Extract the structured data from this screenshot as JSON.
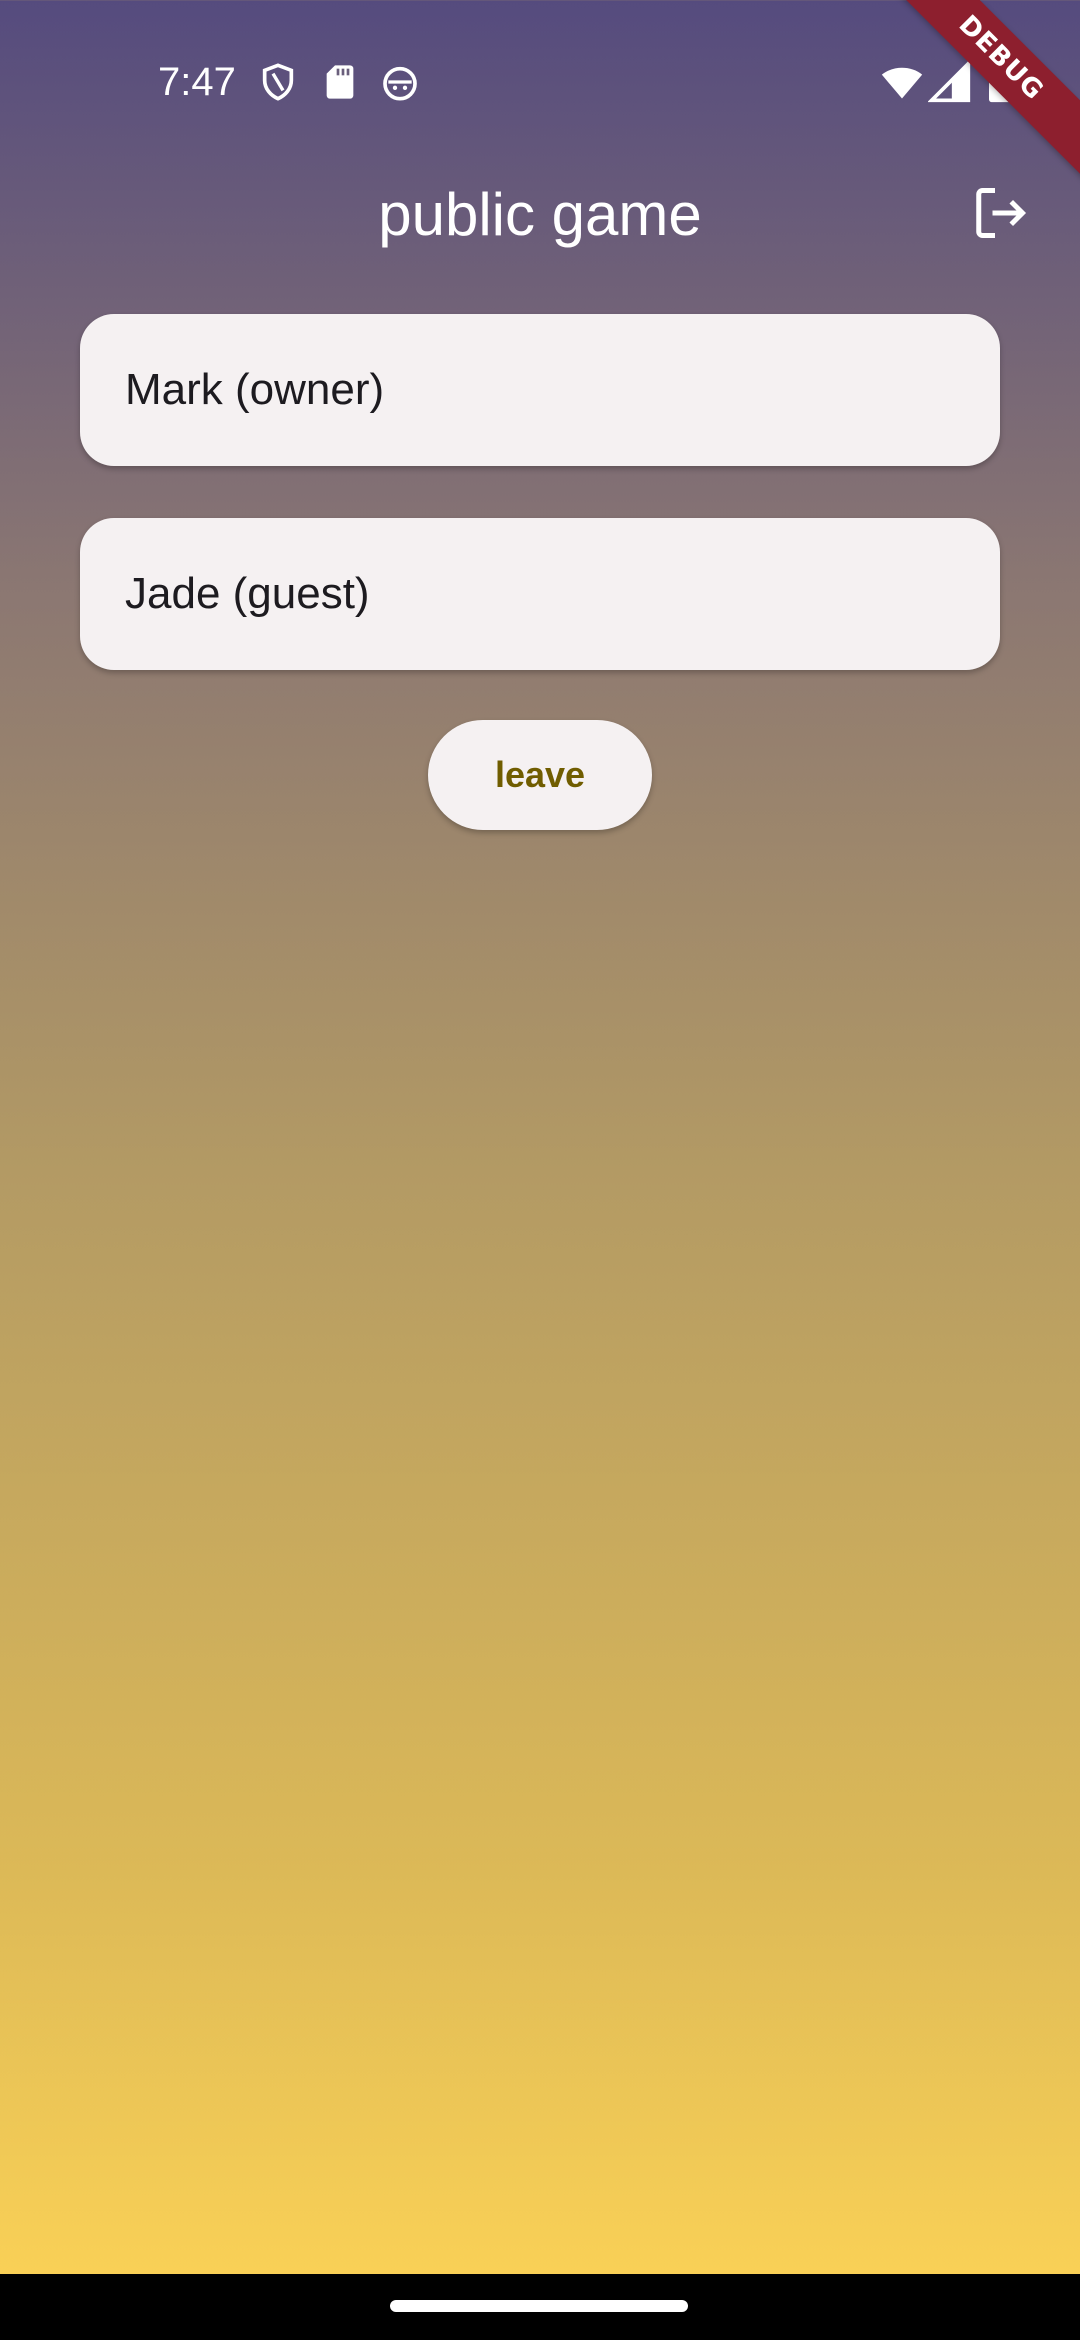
{
  "status_bar": {
    "time": "7:47",
    "left_icons": [
      "shield-icon",
      "sd-card-icon",
      "android-face-icon"
    ],
    "right_icons": [
      "wifi-icon",
      "cell-signal-icon",
      "battery-icon"
    ]
  },
  "debug_banner": {
    "label": "DEBUG"
  },
  "app_bar": {
    "title": "public game",
    "action_icon": "logout-icon"
  },
  "players": [
    {
      "label": "Mark (owner)"
    },
    {
      "label": "Jade (guest)"
    }
  ],
  "actions": {
    "leave_label": "leave"
  },
  "colors": {
    "gradient_top": "#554b7e",
    "gradient_bottom": "#fed456",
    "card_bg": "#f5f1f2",
    "button_text": "#705d00",
    "debug_banner": "#8d1f2e"
  }
}
